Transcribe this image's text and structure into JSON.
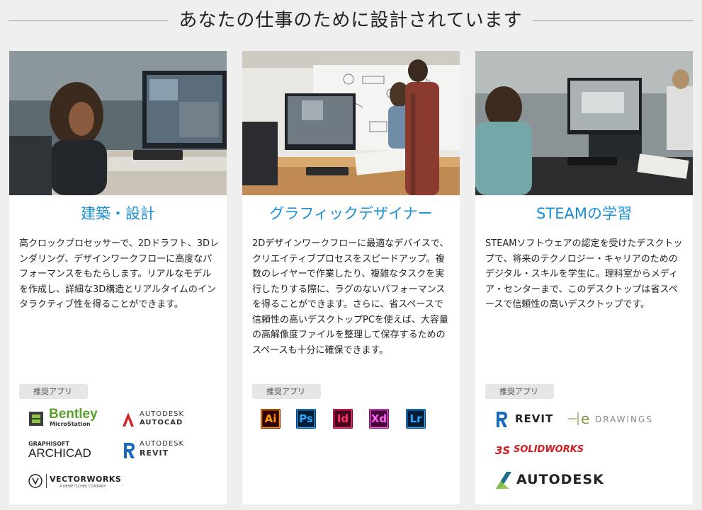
{
  "header": {
    "title": "あなたの仕事のために設計されています"
  },
  "cards": [
    {
      "title": "建築・設計",
      "body": "高クロックプロセッサーで、2Dドラフト、3Dレンダリング、デザインワークフローに高度なパフォーマンスをもたらします。リアルなモデルを作成し、詳細な3D構造とリアルタイムのインタラクティブ性を得ることができます。",
      "rec_label": "推奨アプリ",
      "logos": {
        "bentley": "Bentley",
        "bentley_sub": "MicroStation",
        "autodesk": "AUTODESK",
        "autocad": "AUTOCAD",
        "graphisoft": "GRAPHISOFT",
        "archicad": "ARCHICAD",
        "autodesk2": "AUTODESK",
        "revit": "REVIT",
        "vectorworks": "VECTORWORKS",
        "vectorworks_sub": "A NEMETSCHEK COMPANY"
      }
    },
    {
      "title": "グラフィックデザイナー",
      "body": "2Dデザインワークフローに最適なデバイスで、クリエイティブプロセスをスピードアップ。複数のレイヤーで作業したり、複雑なタスクを実行したりする際に、ラグのないパフォーマンスを得ることができます。さらに、省スペースで信頼性の高いデスクトップPCを使えば、大容量の高解像度ファイルを整理して保存するためのスペースも十分に確保できます。",
      "rec_label": "推奨アプリ",
      "apps": [
        {
          "label": "Ai",
          "bg": "#330000",
          "fg": "#ff9a00"
        },
        {
          "label": "Ps",
          "bg": "#001e36",
          "fg": "#31a8ff"
        },
        {
          "label": "Id",
          "bg": "#49021f",
          "fg": "#ff3366"
        },
        {
          "label": "Xd",
          "bg": "#470137",
          "fg": "#ff61f6"
        },
        {
          "label": "Lr",
          "bg": "#001e36",
          "fg": "#31a8ff"
        }
      ]
    },
    {
      "title": "STEAMの学習",
      "body": "STEAMソフトウェアの認定を受けたデスクトップで、将来のテクノロジー・キャリアのためのデジタル・スキルを学生に。理科室からメディア・センターまで、このデスクトップは省スペースで信頼性の高いデスクトップです。",
      "rec_label": "推奨アプリ",
      "logos": {
        "revit": "REVIT",
        "edrawings": "DRAWINGS",
        "solidworks": "SOLIDWORKS",
        "autodesk": "AUTODESK"
      }
    }
  ],
  "colors": {
    "accent": "#1a8fd6",
    "card_bg": "#ffffff",
    "page_bg": "#efefef"
  }
}
